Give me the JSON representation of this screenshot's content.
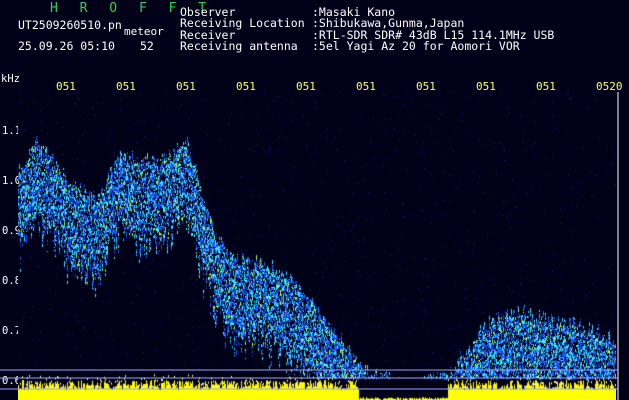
{
  "header": {
    "brand": "H R O F F T",
    "filename": "UT2509260510.pn",
    "filetype": "meteor",
    "datetime": "25.09.26 05:10",
    "count": "52"
  },
  "info": [
    {
      "label": "Observer",
      "value": ":Masaki Kano"
    },
    {
      "label": "Receiving Location",
      "value": ":Shibukawa,Gunma,Japan"
    },
    {
      "label": "Receiver",
      "value": ":RTL-SDR SDR# 43dB L15 114.1MHz USB"
    },
    {
      "label": "Receiving antenna",
      "value": ":5el Yagi Az 20 for Aomori VOR"
    }
  ],
  "axis": {
    "unit": "kHz",
    "y_labels": [
      "1.1",
      "1.0",
      "0.9",
      "0.8",
      "0.7",
      "0.6"
    ],
    "x_labels": [
      "051",
      "051",
      "051",
      "051",
      "051",
      "051",
      "051",
      "051",
      "051",
      "0520"
    ]
  },
  "colors": {
    "background": "#000018",
    "trace_low": "#1a5cff",
    "trace_high": "#39e8ff",
    "trace_hot": "#c8ff30",
    "noise_band": "#ffff00",
    "tick_label": "#ffff66",
    "brand": "#2ad64a"
  },
  "spectrogram": {
    "envelope_khz": [
      [
        0,
        1.02
      ],
      [
        20,
        1.08
      ],
      [
        50,
        1.0
      ],
      [
        80,
        0.96
      ],
      [
        100,
        1.05
      ],
      [
        140,
        1.04
      ],
      [
        170,
        1.08
      ],
      [
        190,
        0.93
      ],
      [
        210,
        0.85
      ],
      [
        250,
        0.83
      ],
      [
        280,
        0.79
      ],
      [
        320,
        0.69
      ],
      [
        345,
        0.62
      ],
      [
        380,
        0.6
      ],
      [
        430,
        0.61
      ],
      [
        470,
        0.72
      ],
      [
        500,
        0.74
      ],
      [
        540,
        0.72
      ],
      [
        580,
        0.7
      ],
      [
        611,
        0.66
      ]
    ]
  }
}
